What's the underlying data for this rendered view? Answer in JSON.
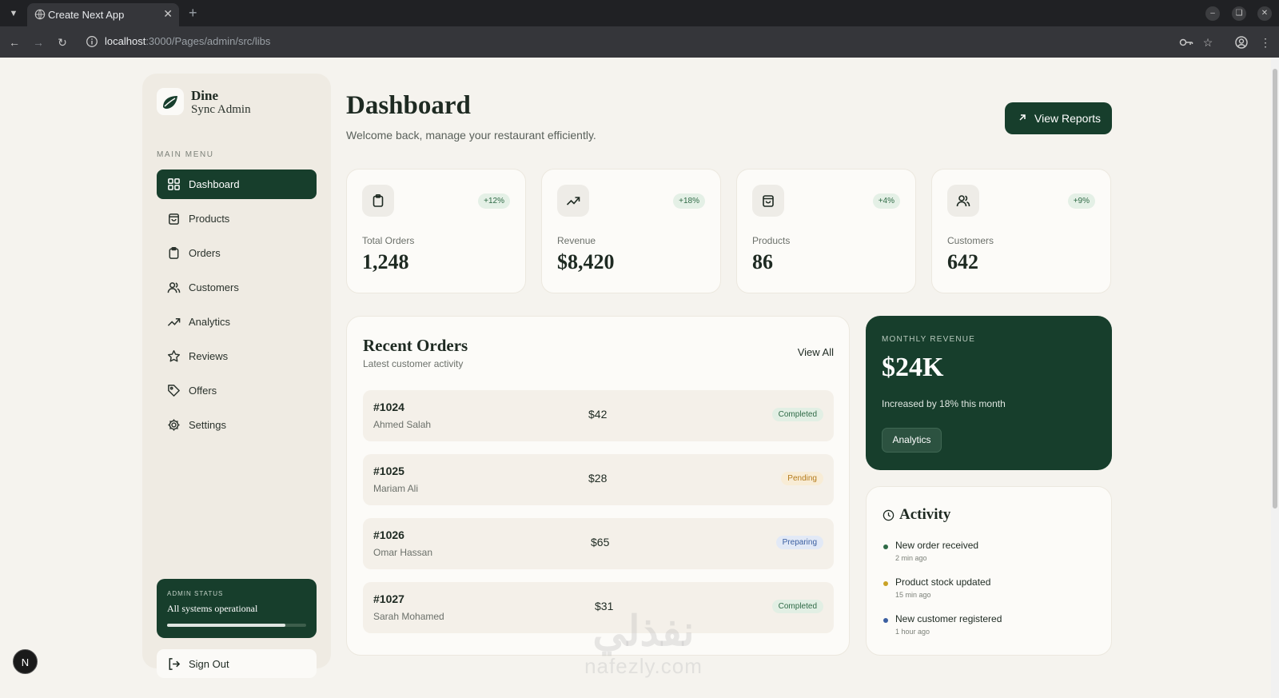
{
  "browser": {
    "tab_title": "Create Next App",
    "url_host": "localhost",
    "url_path": ":3000/Pages/admin/src/libs"
  },
  "sidebar": {
    "brand_line1": "Dine",
    "brand_line2": "Sync Admin",
    "menu_label": "MAIN MENU",
    "items": [
      {
        "label": "Dashboard",
        "icon": "grid-icon",
        "active": true
      },
      {
        "label": "Products",
        "icon": "shopping-bag-icon"
      },
      {
        "label": "Orders",
        "icon": "clipboard-icon"
      },
      {
        "label": "Customers",
        "icon": "users-icon"
      },
      {
        "label": "Analytics",
        "icon": "trending-up-icon"
      },
      {
        "label": "Reviews",
        "icon": "star-icon"
      },
      {
        "label": "Offers",
        "icon": "tag-icon"
      },
      {
        "label": "Settings",
        "icon": "gear-icon"
      }
    ],
    "status": {
      "title": "ADMIN STATUS",
      "text": "All systems operational",
      "progress": 0.85
    },
    "signout_label": "Sign Out"
  },
  "next_badge": "N",
  "header": {
    "title": "Dashboard",
    "subtitle": "Welcome back, manage your restaurant efficiently.",
    "reports_button": "View Reports"
  },
  "stats": [
    {
      "label": "Total Orders",
      "value": "1,248",
      "change": "+12%",
      "icon": "clipboard-icon"
    },
    {
      "label": "Revenue",
      "value": "$8,420",
      "change": "+18%",
      "icon": "trending-up-icon"
    },
    {
      "label": "Products",
      "value": "86",
      "change": "+4%",
      "icon": "shopping-bag-icon"
    },
    {
      "label": "Customers",
      "value": "642",
      "change": "+9%",
      "icon": "users-icon"
    }
  ],
  "orders": {
    "title": "Recent Orders",
    "subtitle": "Latest customer activity",
    "view_all": "View All",
    "rows": [
      {
        "id": "#1024",
        "name": "Ahmed Salah",
        "amount": "$42",
        "status": "Completed"
      },
      {
        "id": "#1025",
        "name": "Mariam Ali",
        "amount": "$28",
        "status": "Pending"
      },
      {
        "id": "#1026",
        "name": "Omar Hassan",
        "amount": "$65",
        "status": "Preparing"
      },
      {
        "id": "#1027",
        "name": "Sarah Mohamed",
        "amount": "$31",
        "status": "Completed"
      }
    ]
  },
  "revenue": {
    "label": "MONTHLY REVENUE",
    "value": "$24K",
    "note": "Increased by 18% this month",
    "button": "Analytics"
  },
  "activity": {
    "title": "Activity",
    "items": [
      {
        "text": "New order received",
        "time": "2 min ago",
        "color": "#2f6a46"
      },
      {
        "text": "Product stock updated",
        "time": "15 min ago",
        "color": "#c9a227"
      },
      {
        "text": "New customer registered",
        "time": "1 hour ago",
        "color": "#3b5fa1"
      }
    ]
  },
  "watermark": {
    "arabic": "نفذلي",
    "latin": "nafezly.com"
  }
}
